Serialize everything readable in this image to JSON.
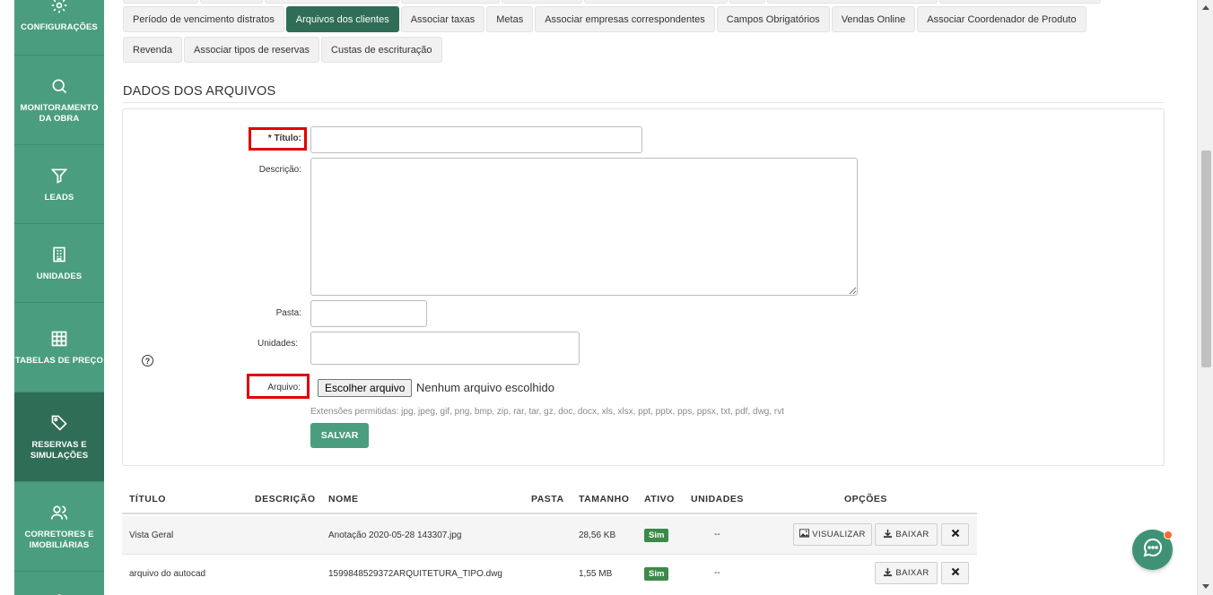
{
  "sidebar": {
    "items": [
      {
        "label": "CONFIGURAÇÕES",
        "icon": "gear-icon"
      },
      {
        "label": "MONITORAMENTO DA OBRA",
        "icon": "search-icon"
      },
      {
        "label": "LEADS",
        "icon": "funnel-icon"
      },
      {
        "label": "UNIDADES",
        "icon": "building-icon"
      },
      {
        "label": "TABELAS DE PREÇO",
        "icon": "grid-icon"
      },
      {
        "label": "RESERVAS E SIMULAÇÕES",
        "icon": "tag-icon",
        "active": true
      },
      {
        "label": "CORRETORES E IMOBILIÁRIAS",
        "icon": "users-icon"
      }
    ]
  },
  "tabs": {
    "row1": [
      "Período de vencimento distratos",
      "Arquivos dos clientes",
      "Associar taxas",
      "Metas",
      "Associar empresas correspondentes",
      "Campos Obrigatórios",
      "Vendas Online",
      "Associar Coordenador de Produto"
    ],
    "row2": [
      "Revenda",
      "Associar tipos de reservas",
      "Custas de escrituração"
    ],
    "active": "Arquivos dos clientes"
  },
  "section": {
    "title": "DADOS DOS ARQUIVOS"
  },
  "form": {
    "titulo_label": "* Título:",
    "titulo_value": "",
    "descricao_label": "Descrição:",
    "descricao_value": "",
    "pasta_label": "Pasta:",
    "pasta_value": "",
    "unidades_label": "Unidades:",
    "arquivo_label": "Arquivo:",
    "file_button": "Escolher arquivo",
    "file_status": "Nenhum arquivo escolhido",
    "extensions": "Extensões permitidas: jpg, jpeg, gif, png, bmp, zip, rar, tar, gz, doc, docx, xls, xlsx, ppt, pptx, pps, ppsx, txt, pdf, dwg, rvt",
    "help": "?",
    "save_label": "SALVAR"
  },
  "table": {
    "headers": {
      "titulo": "TÍTULO",
      "descricao": "DESCRIÇÃO",
      "nome": "NOME",
      "pasta": "PASTA",
      "tamanho": "TAMANHO",
      "ativo": "ATIVO",
      "unidades": "UNIDADES",
      "opcoes": "OPÇÕES"
    },
    "rows": [
      {
        "titulo": "Vista Geral",
        "descricao": "",
        "nome": "Anotação 2020-05-28 143307.jpg",
        "pasta": "",
        "tamanho": "28,56 KB",
        "ativo": "Sim",
        "unidades": "--",
        "visualizar": "VISUALIZAR",
        "baixar": "BAIXAR"
      },
      {
        "titulo": "arquivo do autocad",
        "descricao": "",
        "nome": "1599848529372ARQUITETURA_TIPO.dwg",
        "pasta": "",
        "tamanho": "1,55 MB",
        "ativo": "Sim",
        "unidades": "--",
        "baixar": "BAIXAR"
      }
    ]
  },
  "colors": {
    "sidebar": "#4a9e7f",
    "sidebar_active": "#2f6d57",
    "active_tab": "#2f6d57",
    "highlight": "#e00000",
    "badge": "#3c8a4a",
    "chat_dot": "#ff6a2b"
  }
}
